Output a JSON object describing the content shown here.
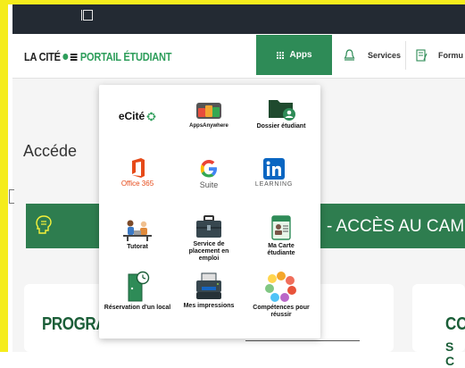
{
  "header": {
    "logo_left": "LA CITÉ",
    "logo_right": "PORTAIL ÉTUDIANT",
    "apps_label": "Apps",
    "services_label": "Services",
    "formulaires_label": "Formu"
  },
  "page": {
    "access_title": "Accéde",
    "banner_text": "- ACCÈS AU CAM",
    "card_left_title": "PROGRA",
    "card_right_title": "CO",
    "card_right_sub": "S C"
  },
  "apps": {
    "ecite": "eCité",
    "appsanywhere": "AppsAnywhere",
    "dossier": "Dossier étudiant",
    "office365": "Office 365",
    "gsuite": "Suite",
    "learning": "LEARNING",
    "tutorat": "Tutorat",
    "placement": "Service de placement en emploi",
    "carte": "Ma Carte étudiante",
    "reservation": "Réservation d'un local",
    "impressions": "Mes impressions",
    "competences": "Compétences pour réussir"
  },
  "colors": {
    "brand_green": "#2e8b57",
    "dark_green": "#1b5e38",
    "highlight_yellow": "#f7f23a",
    "titlebar": "#232a33"
  }
}
